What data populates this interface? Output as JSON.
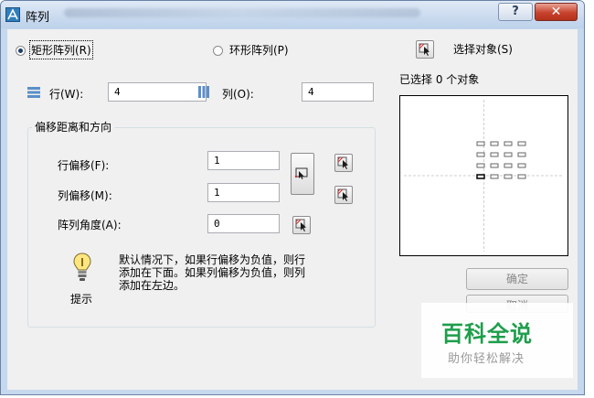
{
  "window": {
    "title": "阵列",
    "help_label": "?",
    "close_label": "✕"
  },
  "array_type": {
    "rect_label": "矩形阵列(R)",
    "polar_label": "环形阵列(P)",
    "selected": "rect"
  },
  "select": {
    "button_label": "选择对象(S)",
    "status": "已选择 0 个对象"
  },
  "rows_cols": {
    "rows_label": "行(W):",
    "rows_value": "4",
    "cols_label": "列(O):",
    "cols_value": "4"
  },
  "offset": {
    "group_label": "偏移距离和方向",
    "row_offset_label": "行偏移(F):",
    "row_offset_value": "1",
    "col_offset_label": "列偏移(M):",
    "col_offset_value": "1",
    "angle_label": "阵列角度(A):",
    "angle_value": "0"
  },
  "tip": {
    "label": "提示",
    "text_line1": "默认情况下，如果行偏移为负值，则行",
    "text_line2": "添加在下面。如果列偏移为负值，则列",
    "text_line3": "添加在左边。"
  },
  "buttons": {
    "ok": "确定",
    "cancel": "取消"
  },
  "watermark": {
    "title": "百科全说",
    "subtitle": "助你轻松解决"
  },
  "colors": {
    "watermark_green": "#1e9e4b",
    "close_red": "#c7432d"
  }
}
